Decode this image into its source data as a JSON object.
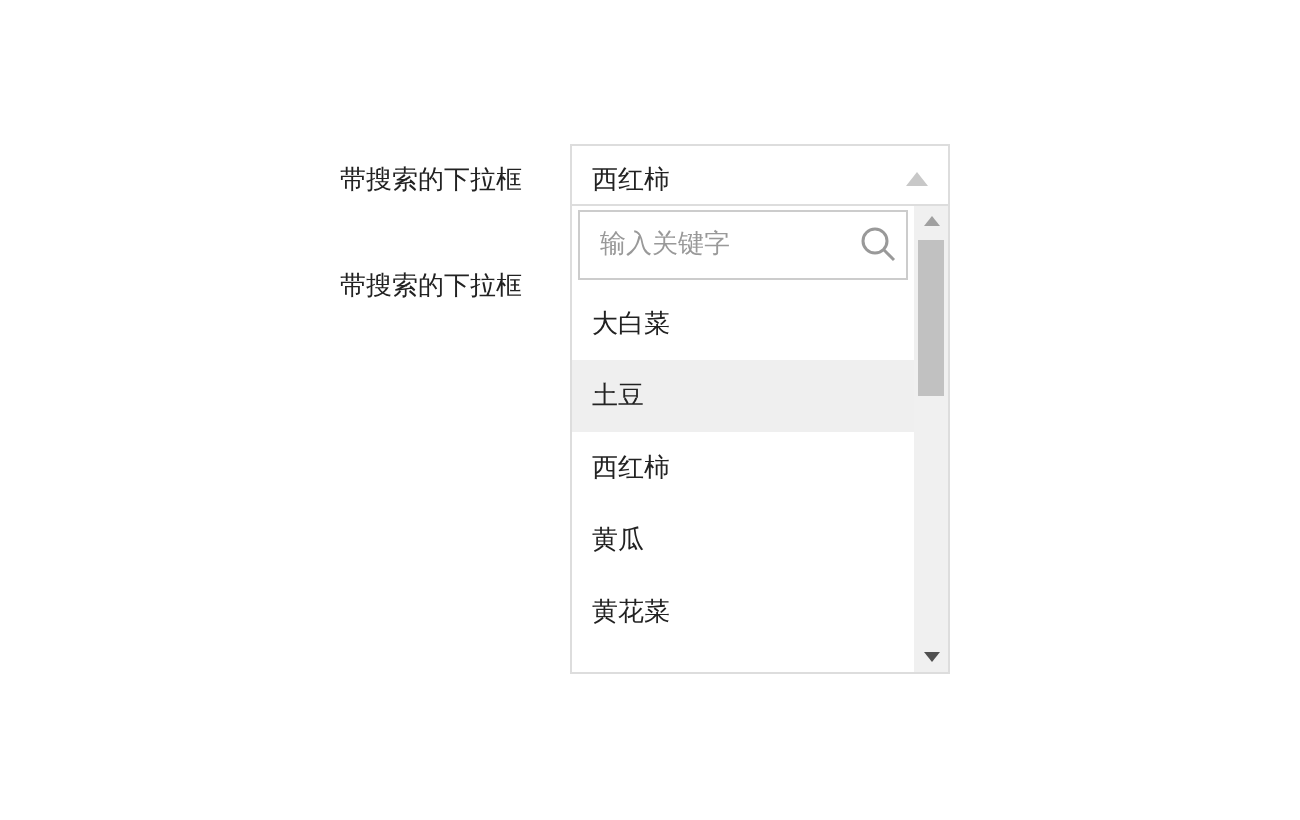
{
  "rows": [
    {
      "label": "带搜索的下拉框"
    },
    {
      "label": "带搜索的下拉框"
    }
  ],
  "select": {
    "value": "西红柿",
    "expanded": true,
    "search": {
      "placeholder": "输入关键字"
    },
    "options": [
      {
        "label": "大白菜",
        "hovered": false
      },
      {
        "label": "土豆",
        "hovered": true
      },
      {
        "label": "西红柿",
        "hovered": false
      },
      {
        "label": "黄瓜",
        "hovered": false
      },
      {
        "label": "黄花菜",
        "hovered": false
      }
    ]
  }
}
